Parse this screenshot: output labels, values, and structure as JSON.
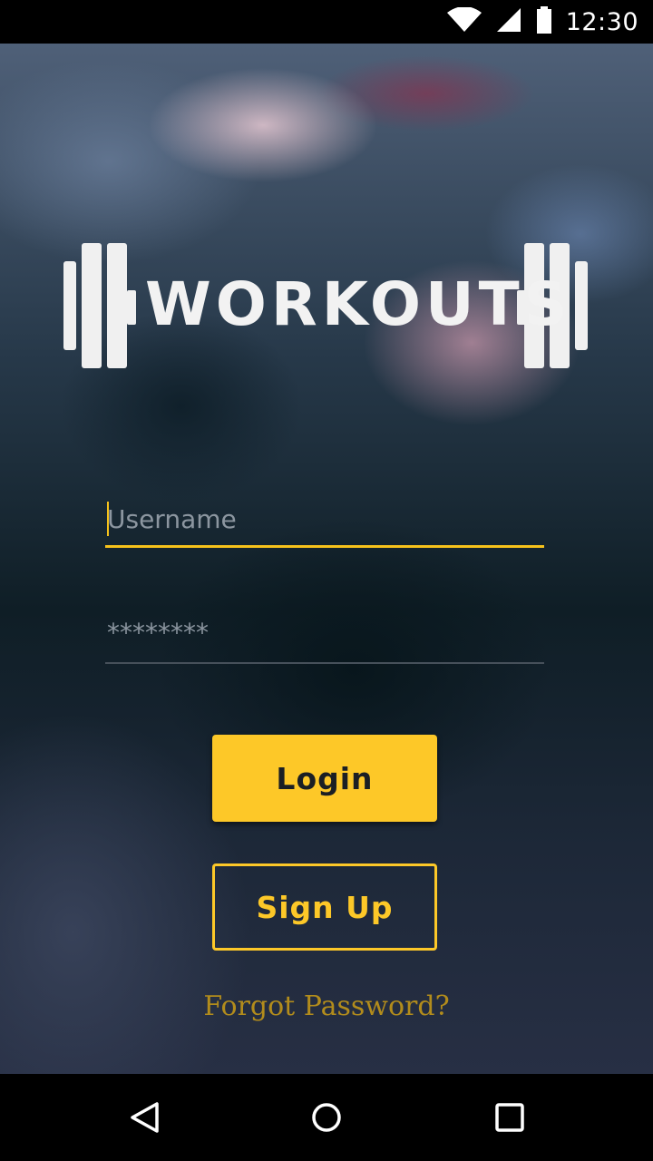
{
  "status_bar": {
    "time": "12:30",
    "icons": [
      "wifi-icon",
      "cellular-signal-icon",
      "battery-icon"
    ]
  },
  "logo": {
    "text": "WORKOUTS",
    "icon": "dumbbell-icon"
  },
  "login_form": {
    "username_placeholder": "Username",
    "username_value": "",
    "password_placeholder": "********",
    "password_value": "",
    "login_label": "Login",
    "signup_label": "Sign Up",
    "forgot_password_label": "Forgot Password?"
  },
  "nav_bar": {
    "icons": [
      "back-triangle-icon",
      "home-circle-icon",
      "recents-square-icon"
    ]
  },
  "colors": {
    "accent": "#fdc828",
    "forgot_link": "#b28c1c",
    "status_bar": "#000000",
    "nav_bar": "#000000"
  }
}
